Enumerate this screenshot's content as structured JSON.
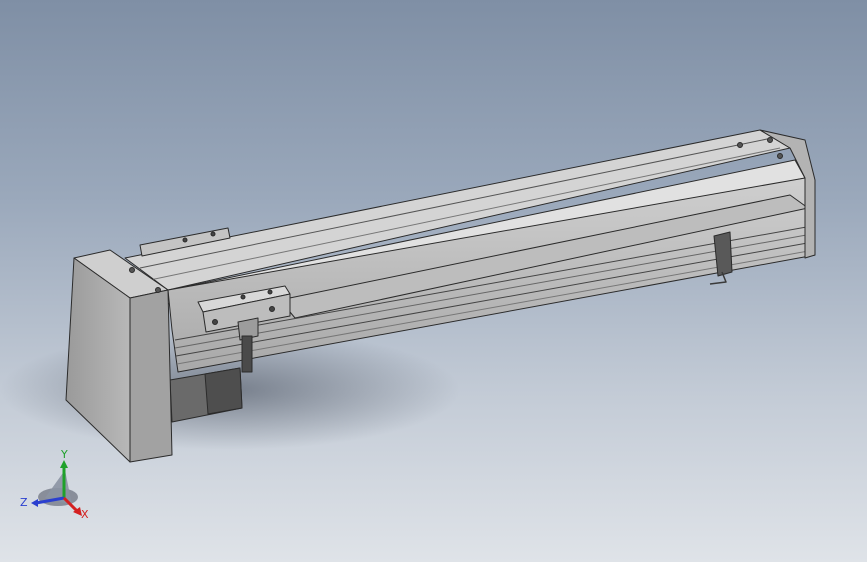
{
  "viewport": {
    "background_top": "#7f8fa5",
    "background_bottom": "#dfe3e8"
  },
  "model": {
    "body_color": "#c9c9c9",
    "top_color": "#d6d6d6",
    "shade_color": "#8f8f8f",
    "dark_color": "#5a5a5a",
    "edge_color": "#2b2b2b"
  },
  "triad": {
    "x_label": "X",
    "y_label": "Y",
    "z_label": "Z",
    "x_color": "#d42020",
    "y_color": "#1fa12a",
    "z_color": "#2a3fcf"
  }
}
